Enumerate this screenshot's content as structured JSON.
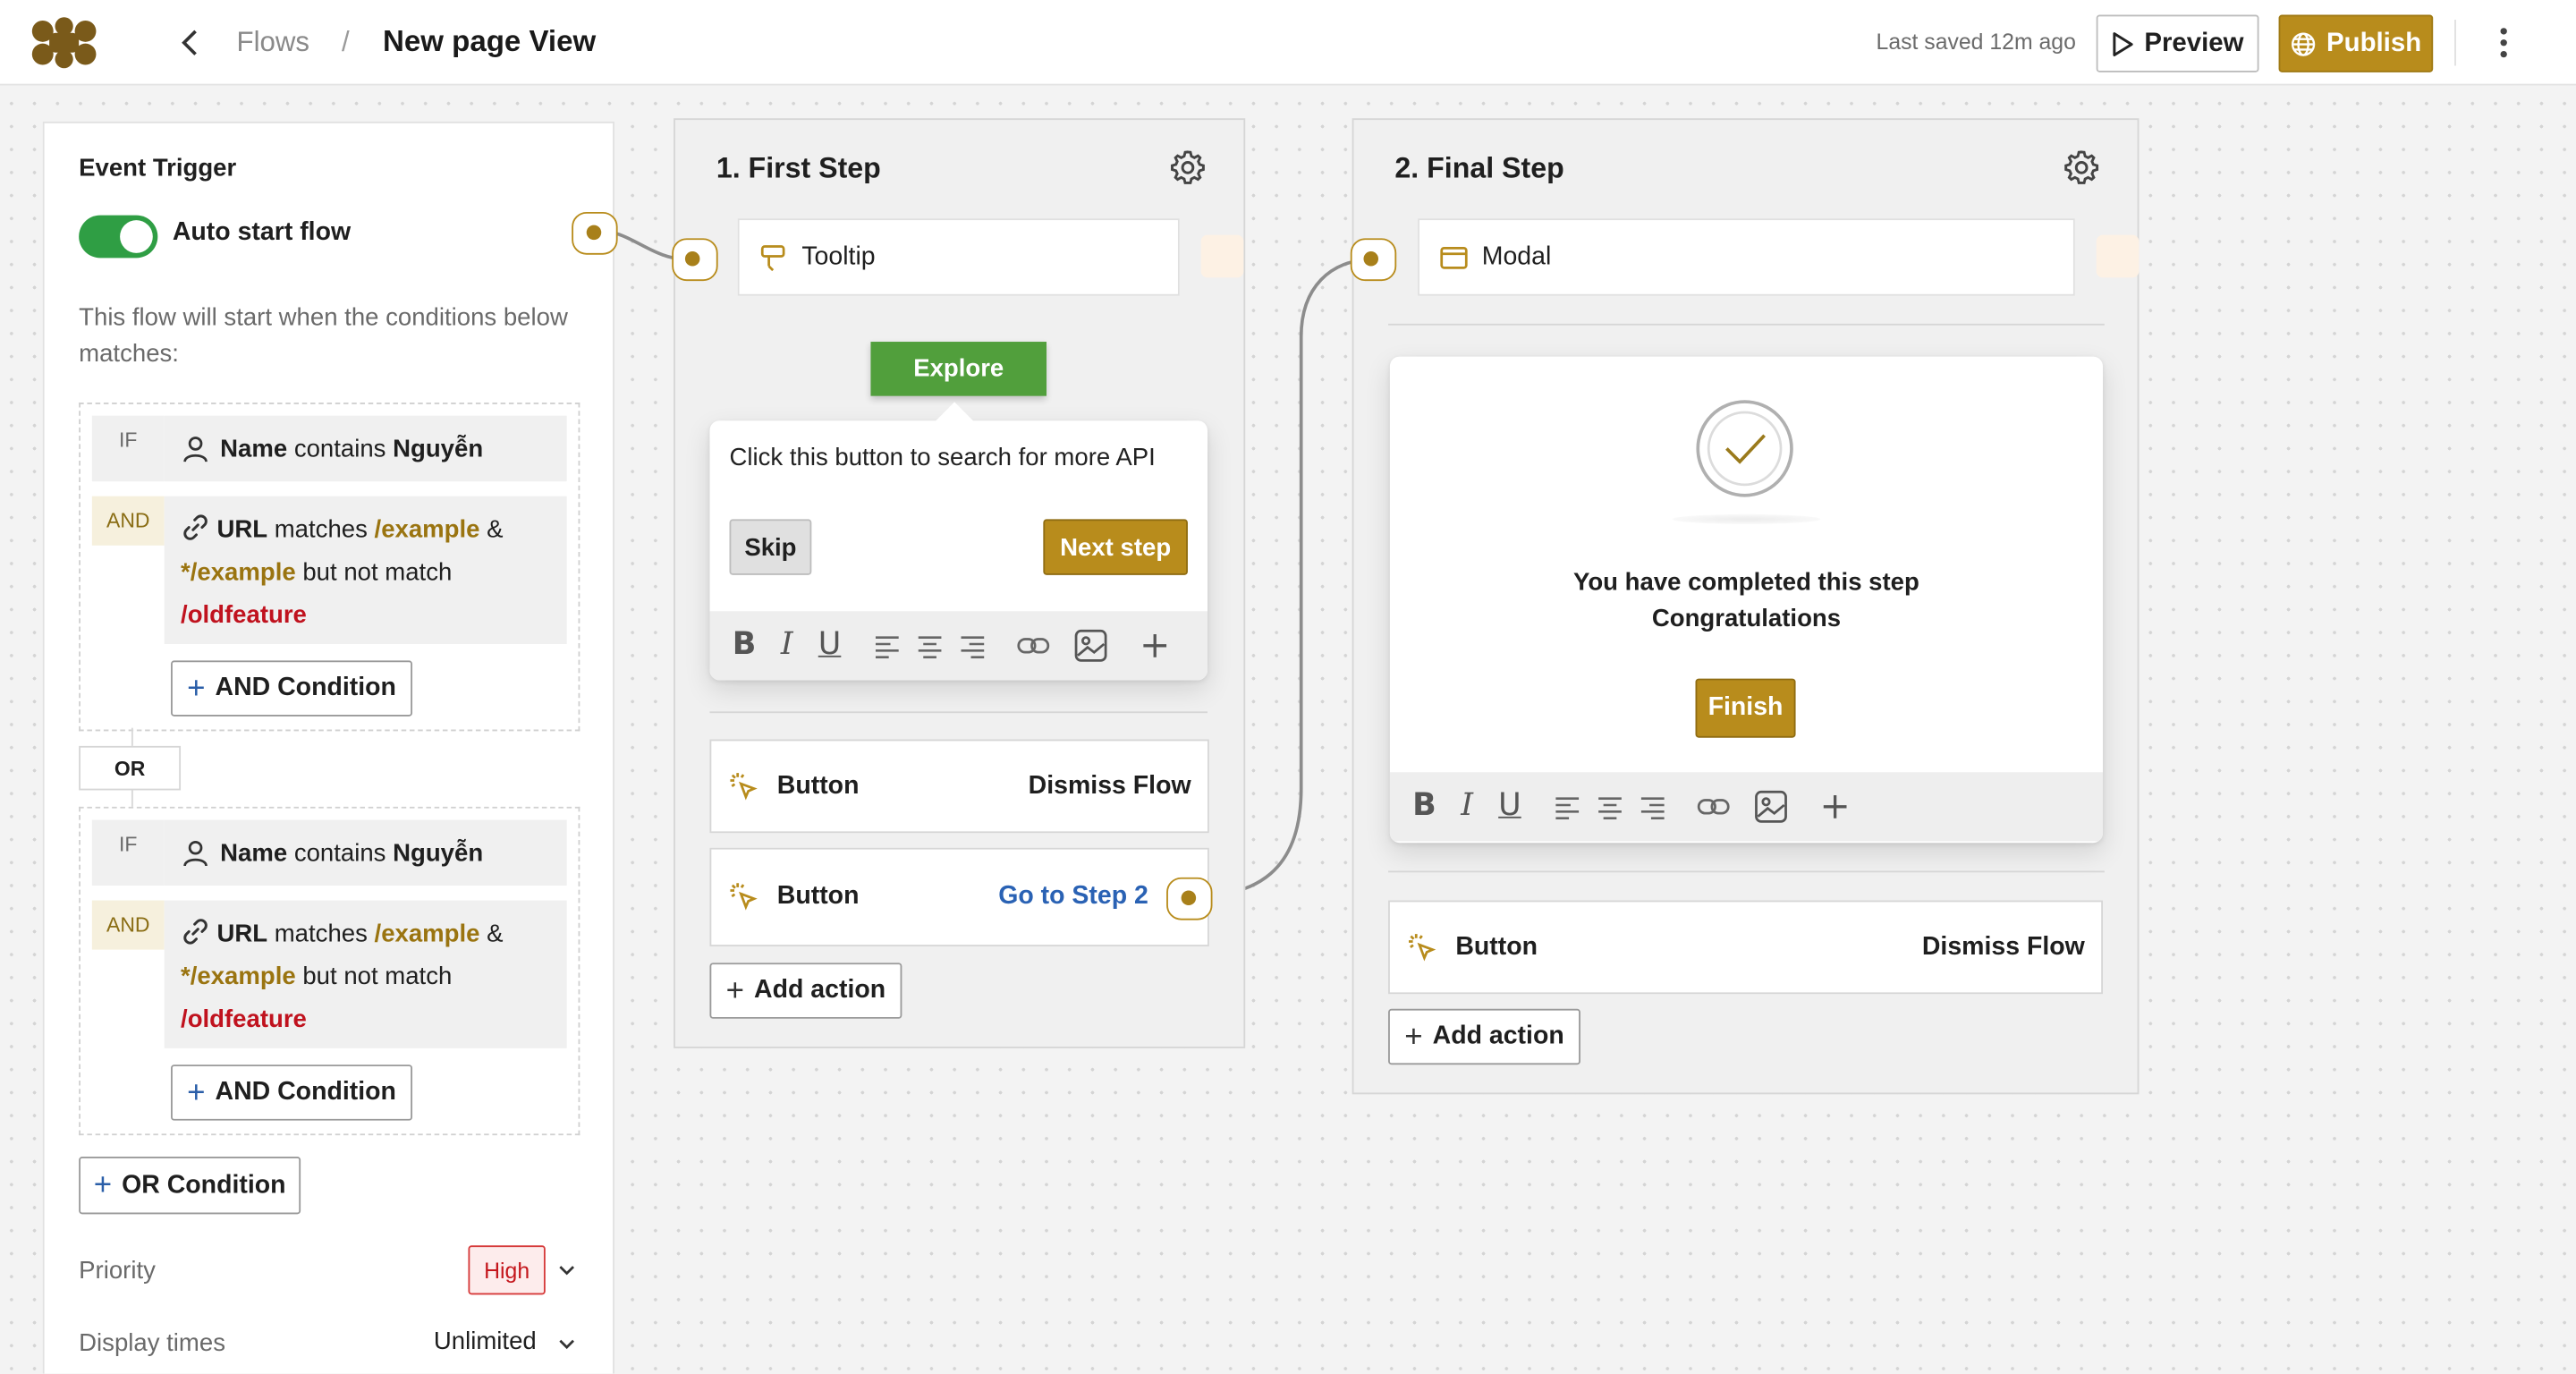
{
  "header": {
    "breadcrumb_parent": "Flows",
    "breadcrumb_separator": "/",
    "page_title": "New page View",
    "last_saved": "Last saved 12m ago",
    "preview_label": "Preview",
    "publish_label": "Publish",
    "accent_color": "#b88c1c"
  },
  "trigger": {
    "title": "Event Trigger",
    "toggle_label": "Auto start flow",
    "toggle_on": true,
    "description": "This flow will start when the conditions below matches:",
    "groups": [
      {
        "if_tag": "IF",
        "name_field": "Name",
        "name_op": "contains",
        "name_value": "Nguyễn",
        "and_tag": "AND",
        "url_field": "URL",
        "url_op": "matches",
        "url_value1": "/example",
        "url_amp": "&",
        "url_value2": "*/example",
        "url_op2": "but not match",
        "url_value3": "/oldfeature",
        "and_condition_label": "AND Condition"
      },
      {
        "if_tag": "IF",
        "name_field": "Name",
        "name_op": "contains",
        "name_value": "Nguyễn",
        "and_tag": "AND",
        "url_field": "URL",
        "url_op": "matches",
        "url_value1": "/example",
        "url_amp": "&",
        "url_value2": "*/example",
        "url_op2": "but not match",
        "url_value3": "/oldfeature",
        "and_condition_label": "AND Condition"
      }
    ],
    "or_chip": "OR",
    "or_condition_label": "OR Condition",
    "priority_label": "Priority",
    "priority_value": "High",
    "display_times_label": "Display times",
    "display_times_value": "Unlimited"
  },
  "steps": [
    {
      "title": "1. First Step",
      "element_label": "Tooltip",
      "target_label": "Explore",
      "tooltip_text": "Click this button to search for more API",
      "skip_label": "Skip",
      "next_label": "Next step",
      "actions": [
        {
          "type": "Button",
          "action": "Dismiss Flow"
        },
        {
          "type": "Button",
          "action": "Go to Step 2"
        }
      ],
      "add_action_label": "Add action"
    },
    {
      "title": "2. Final Step",
      "element_label": "Modal",
      "modal_line1": "You have completed this step",
      "modal_line2": "Congratulations",
      "finish_label": "Finish",
      "actions": [
        {
          "type": "Button",
          "action": "Dismiss Flow"
        }
      ],
      "add_action_label": "Add action"
    }
  ],
  "toolbar_icons": [
    "bold-icon",
    "italic-icon",
    "underline-icon",
    "align-left-icon",
    "align-center-icon",
    "align-right-icon",
    "link-icon",
    "image-icon",
    "plus-icon"
  ],
  "toolbar_letters": {
    "bold": "B",
    "italic": "I",
    "underline": "U"
  }
}
